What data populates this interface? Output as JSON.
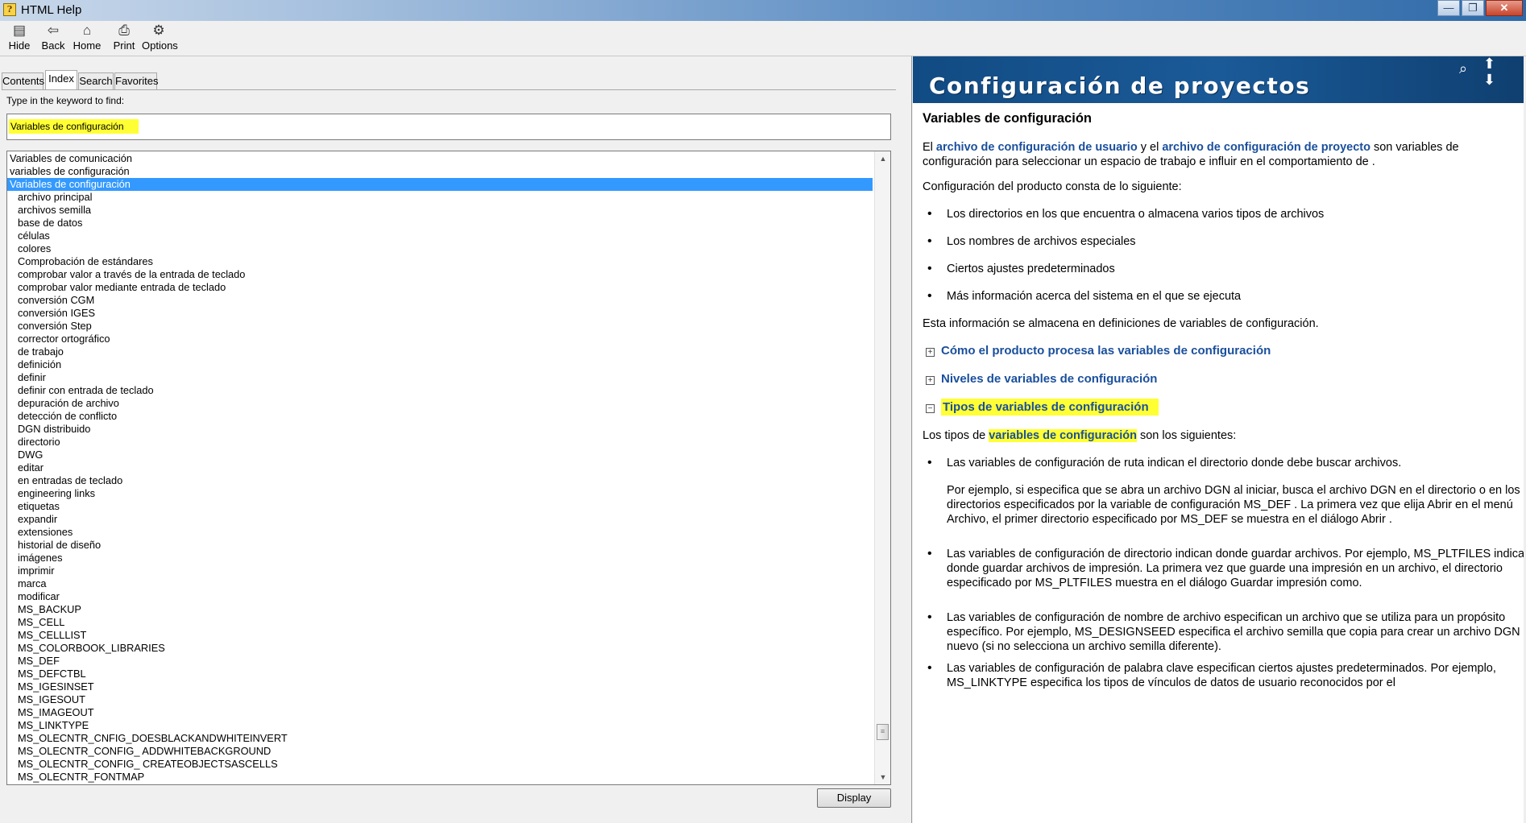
{
  "window": {
    "title": "HTML Help",
    "minimize": "—",
    "maximize": "❐",
    "close": "✕"
  },
  "toolbar": {
    "hide": "Hide",
    "back": "Back",
    "home": "Home",
    "print": "Print",
    "options": "Options"
  },
  "tabs": {
    "contents": "Contents",
    "index": "Index",
    "search": "Search",
    "favorites": "Favorites"
  },
  "index": {
    "keyword_label": "Type in the keyword to find:",
    "keyword_value": "Variables de configuración",
    "display_button": "Display",
    "items": [
      {
        "text": "Variables de comunicación",
        "level": 0
      },
      {
        "text": "variables de configuración",
        "level": 0
      },
      {
        "text": "Variables de configuración",
        "level": 0,
        "selected": true
      },
      {
        "text": "archivo principal",
        "level": 1
      },
      {
        "text": "archivos semilla",
        "level": 1
      },
      {
        "text": "base de datos",
        "level": 1
      },
      {
        "text": "células",
        "level": 1
      },
      {
        "text": "colores",
        "level": 1
      },
      {
        "text": "Comprobación de estándares",
        "level": 1
      },
      {
        "text": "comprobar valor a través de la entrada de teclado",
        "level": 1
      },
      {
        "text": "comprobar valor mediante entrada de teclado",
        "level": 1
      },
      {
        "text": "conversión CGM",
        "level": 1
      },
      {
        "text": "conversión IGES",
        "level": 1
      },
      {
        "text": "conversión Step",
        "level": 1
      },
      {
        "text": "corrector ortográfico",
        "level": 1
      },
      {
        "text": "de trabajo",
        "level": 1
      },
      {
        "text": "definición",
        "level": 1
      },
      {
        "text": "definir",
        "level": 1
      },
      {
        "text": "definir con entrada de teclado",
        "level": 1
      },
      {
        "text": "depuración de archivo",
        "level": 1
      },
      {
        "text": "detección de conflicto",
        "level": 1
      },
      {
        "text": "DGN distribuido",
        "level": 1
      },
      {
        "text": "directorio",
        "level": 1
      },
      {
        "text": "DWG",
        "level": 1
      },
      {
        "text": "editar",
        "level": 1
      },
      {
        "text": "en entradas de teclado",
        "level": 1
      },
      {
        "text": "engineering links",
        "level": 1
      },
      {
        "text": "etiquetas",
        "level": 1
      },
      {
        "text": "expandir",
        "level": 1
      },
      {
        "text": "extensiones",
        "level": 1
      },
      {
        "text": "historial de diseño",
        "level": 1
      },
      {
        "text": "imágenes",
        "level": 1
      },
      {
        "text": "imprimir",
        "level": 1
      },
      {
        "text": "marca",
        "level": 1
      },
      {
        "text": "modificar",
        "level": 1
      },
      {
        "text": "MS_BACKUP",
        "level": 1
      },
      {
        "text": "MS_CELL",
        "level": 1
      },
      {
        "text": "MS_CELLLIST",
        "level": 1
      },
      {
        "text": "MS_COLORBOOK_LIBRARIES",
        "level": 1
      },
      {
        "text": "MS_DEF",
        "level": 1
      },
      {
        "text": "MS_DEFCTBL",
        "level": 1
      },
      {
        "text": "MS_IGESINSET",
        "level": 1
      },
      {
        "text": "MS_IGESOUT",
        "level": 1
      },
      {
        "text": "MS_IMAGEOUT",
        "level": 1
      },
      {
        "text": "MS_LINKTYPE",
        "level": 1
      },
      {
        "text": "MS_OLECNTR_CNFIG_DOESBLACKANDWHITEINVERT",
        "level": 1
      },
      {
        "text": "MS_OLECNTR_CONFIG_ ADDWHITEBACKGROUND",
        "level": 1
      },
      {
        "text": "MS_OLECNTR_CONFIG_ CREATEOBJECTSASCELLS",
        "level": 1
      },
      {
        "text": "MS_OLECNTR_FONTMAP",
        "level": 1
      }
    ]
  },
  "topic": {
    "banner_title": "Configuración de proyectos",
    "heading": "Variables de configuración",
    "intro_pre": "El ",
    "intro_link1": "archivo de configuración de usuario",
    "intro_mid": " y el ",
    "intro_link2": "archivo de configuración de proyecto",
    "intro_post": " son variables de configuración para seleccionar un espacio de trabajo e influir en el comportamiento de .",
    "consists": "Configuración del producto consta de lo siguiente:",
    "bullets": [
      "Los directorios en los que encuentra o almacena varios tipos de archivos",
      "Los nombres de archivos especiales",
      "Ciertos ajustes predeterminados",
      "Más información acerca del sistema en el que se ejecuta"
    ],
    "stored": "Esta información se almacena en definiciones de variables de configuración.",
    "exp1": "Cómo el producto procesa las variables de configuración",
    "exp2": "Niveles de variables de configuración",
    "exp3": "Tipos de variables de configuración",
    "types_pre": "Los tipos de ",
    "types_link": "variables de configuración",
    "types_post": " son los siguientes:",
    "type_bullets": [
      "Las variables de configuración de ruta indican el directorio donde debe buscar archivos.",
      "Las variables de configuración de directorio indican donde guardar archivos. Por ejemplo, MS_PLTFILES indica donde guardar archivos de impresión. La primera vez que guarde una impresión en un archivo, el directorio especificado por MS_PLTFILES muestra en el diálogo Guardar impresión como.",
      "Las variables de configuración de nombre de archivo especifican un archivo que se utiliza para un propósito específico. Por ejemplo, MS_DESIGNSEED especifica el archivo semilla que copia para crear un archivo DGN nuevo (si no selecciona un archivo semilla diferente).",
      "Las variables de configuración de palabra clave especifican ciertos ajustes predeterminados. Por ejemplo, MS_LINKTYPE especifica los tipos de vínculos de datos de usuario reconocidos por el"
    ],
    "example": "Por ejemplo, si especifica que se abra un archivo DGN al iniciar, busca el archivo DGN en el directorio o en los directorios especificados por la variable de configuración MS_DEF . La primera vez que elija Abrir en el menú Archivo, el primer directorio especificado por MS_DEF se muestra en el diálogo Abrir ."
  }
}
